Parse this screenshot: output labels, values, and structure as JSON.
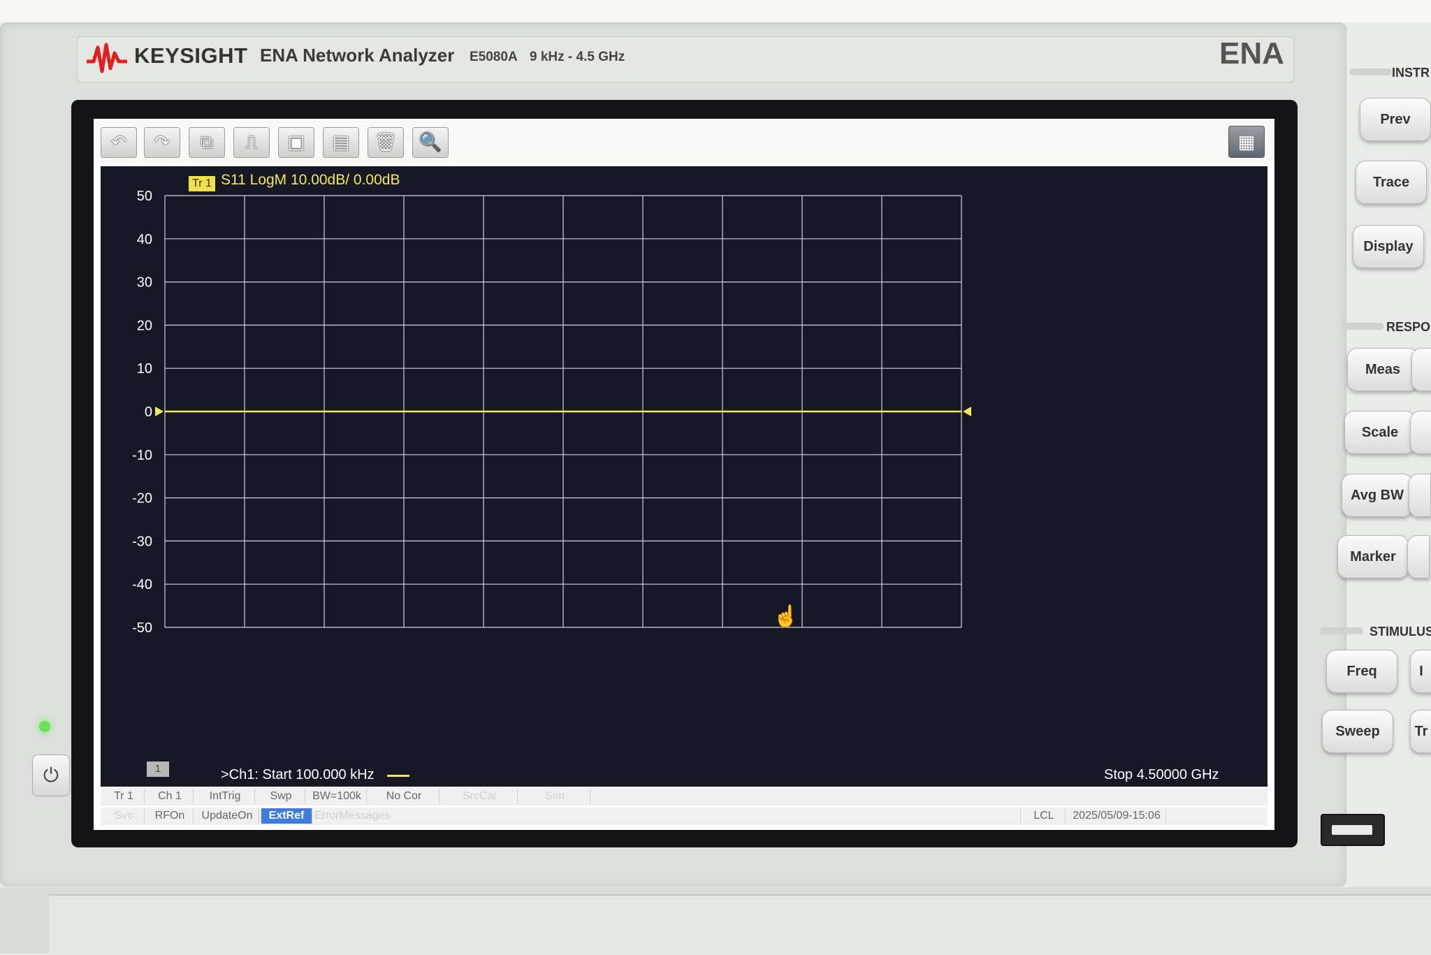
{
  "header": {
    "brand": "KEYSIGHT",
    "product": "ENA Network Analyzer",
    "model": "E5080A",
    "freq_range": "9 kHz - 4.5 GHz",
    "series_badge": "ENA"
  },
  "toolbar": {
    "icons": [
      "undo-icon",
      "redo-icon",
      "camera-icon",
      "marker-icon",
      "screen-save-icon",
      "folder-icon",
      "trash-icon",
      "zoom-icon",
      "grid-menu-icon"
    ],
    "glyphs": [
      "↶",
      "↷",
      "⧉",
      "⎍",
      "▣",
      "▤",
      "🗑",
      "🔍",
      "▦"
    ]
  },
  "trace": {
    "tag": "Tr 1",
    "title": "S11 LogM 10.00dB/  0.00dB",
    "color": "#f2e85a"
  },
  "channel": {
    "number": "1",
    "start": ">Ch1:  Start  100.000 kHz",
    "stop": "Stop  4.50000 GHz"
  },
  "chart_data": {
    "type": "line",
    "y_ticks": [
      "50",
      "40",
      "30",
      "20",
      "10",
      "0",
      "-10",
      "-20",
      "-30",
      "-40",
      "-50"
    ],
    "ylim": [
      -50,
      50
    ],
    "xlim_ghz": [
      0.0001,
      4.5
    ],
    "grid": true,
    "series": [
      {
        "name": "S11",
        "x": [
          0.0001,
          0.45,
          0.9,
          1.35,
          1.8,
          2.25,
          2.7,
          3.15,
          3.6,
          4.05,
          4.5
        ],
        "values": [
          0,
          0,
          0,
          0,
          0,
          0,
          0,
          0,
          0,
          0,
          0
        ]
      }
    ]
  },
  "status_row1": [
    {
      "label": "Tr 1",
      "state": "normal"
    },
    {
      "label": "Ch 1",
      "state": "normal"
    },
    {
      "label": "IntTrig",
      "state": "normal"
    },
    {
      "label": "Swp",
      "state": "normal"
    },
    {
      "label": "BW=100k",
      "state": "normal"
    },
    {
      "label": "No Cor",
      "state": "normal"
    },
    {
      "label": "SrcCal",
      "state": "dim"
    },
    {
      "label": "Sim",
      "state": "dim"
    }
  ],
  "status_row2": [
    {
      "label": "Svc",
      "state": "dim"
    },
    {
      "label": "RFOn",
      "state": "normal"
    },
    {
      "label": "UpdateOn",
      "state": "normal"
    },
    {
      "label": "ExtRef",
      "state": "highlight"
    },
    {
      "label": "ErrorMessages",
      "state": "dim"
    },
    {
      "label": "LCL",
      "state": "normal"
    },
    {
      "label": "2025/05/09-15:06",
      "state": "normal"
    }
  ],
  "side_panel": {
    "sections": [
      "INSTR",
      "RESPO",
      "STIMULUS"
    ],
    "buttons": [
      "Prev",
      "Trace",
      "Display",
      "Meas",
      "Scale",
      "Avg BW",
      "Marker",
      "Freq",
      "Sweep"
    ],
    "partial_buttons": [
      "",
      "",
      "",
      "",
      "",
      "I",
      "Tr"
    ]
  }
}
